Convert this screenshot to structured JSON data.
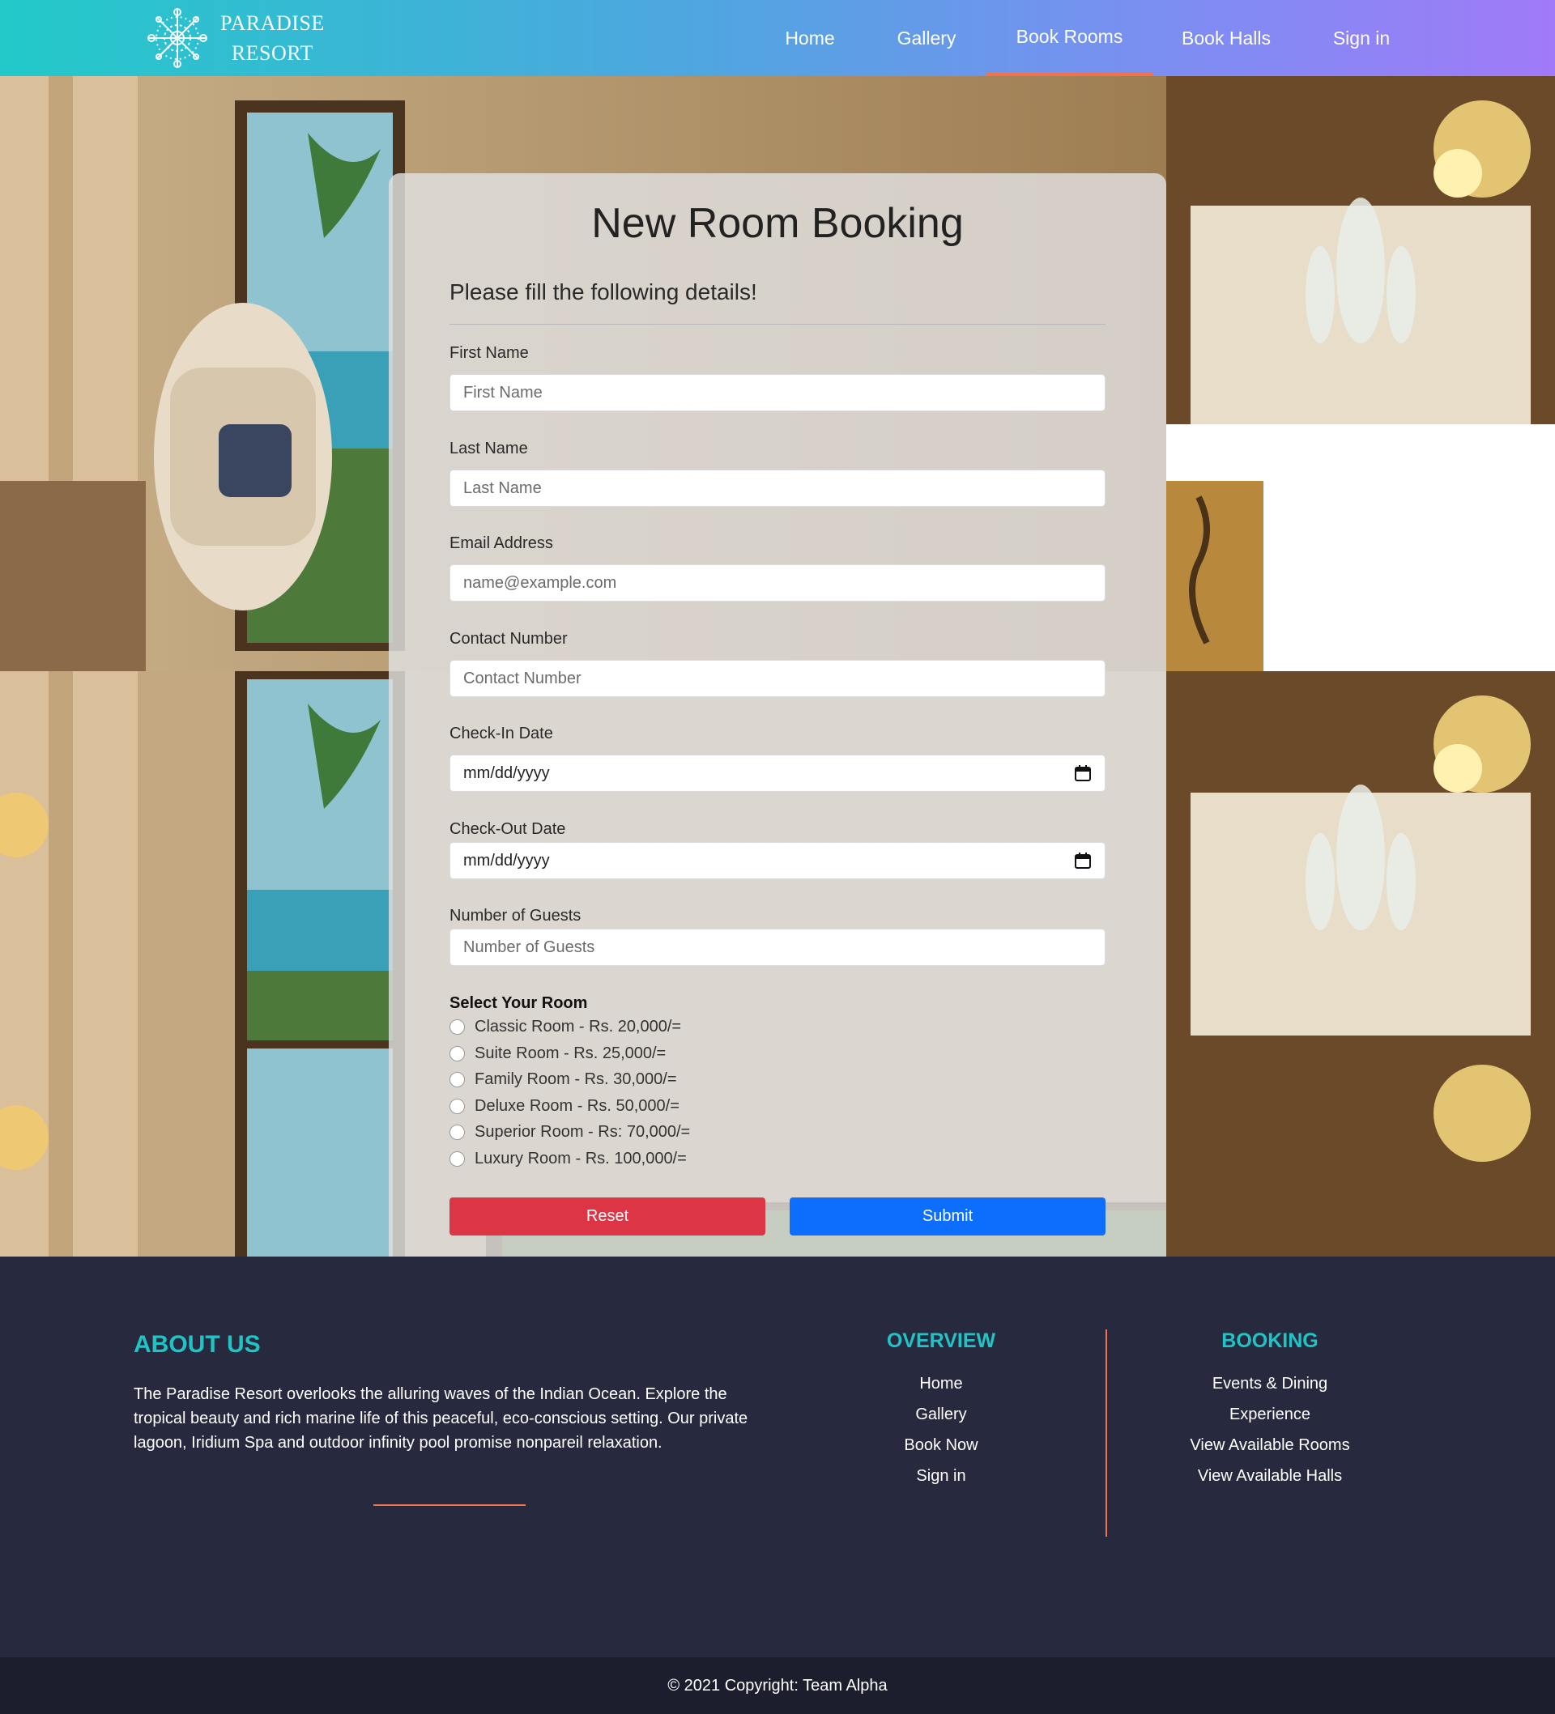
{
  "brand": {
    "line1": "PARADISE",
    "line2": "RESORT"
  },
  "nav": {
    "items": [
      {
        "label": "Home"
      },
      {
        "label": "Gallery"
      },
      {
        "label": "Book Rooms",
        "active": true
      },
      {
        "label": "Book Halls"
      },
      {
        "label": "Sign in"
      }
    ]
  },
  "form": {
    "title": "New Room Booking",
    "subtitle": "Please fill the following details!",
    "fields": {
      "first_name": {
        "label": "First Name",
        "placeholder": "First Name"
      },
      "last_name": {
        "label": "Last Name",
        "placeholder": "Last Name"
      },
      "email": {
        "label": "Email Address",
        "placeholder": "name@example.com"
      },
      "contact": {
        "label": "Contact Number",
        "placeholder": "Contact Number"
      },
      "check_in": {
        "label": "Check-In Date",
        "placeholder": "mm/dd/yyyy"
      },
      "check_out": {
        "label": "Check-Out Date",
        "placeholder": "mm/dd/yyyy"
      },
      "guests": {
        "label": "Number of Guests",
        "placeholder": "Number of Guests"
      }
    },
    "room_heading": "Select Your Room",
    "rooms": [
      {
        "label": "Classic Room - Rs. 20,000/="
      },
      {
        "label": "Suite Room - Rs. 25,000/="
      },
      {
        "label": "Family Room - Rs. 30,000/="
      },
      {
        "label": "Deluxe Room - Rs. 50,000/="
      },
      {
        "label": "Superior Room - Rs: 70,000/="
      },
      {
        "label": "Luxury Room - Rs. 100,000/="
      }
    ],
    "reset_label": "Reset",
    "submit_label": "Submit"
  },
  "footer": {
    "about_title": "ABOUT US",
    "about_text": "The Paradise Resort overlooks the alluring waves of the Indian Ocean. Explore the tropical beauty and rich marine life of this peaceful, eco-conscious setting. Our private lagoon, Iridium Spa and outdoor infinity pool promise nonpareil relaxation.",
    "overview": {
      "title": "OVERVIEW",
      "links": [
        "Home",
        "Gallery",
        "Book Now",
        "Sign in"
      ]
    },
    "booking": {
      "title": "BOOKING",
      "links": [
        "Events & Dining",
        "Experience",
        "View Available Rooms",
        "View Available Halls"
      ]
    },
    "copyright": "© 2021 Copyright: Team Alpha"
  },
  "colors": {
    "accent": "#21c4c4",
    "underline": "#f2724f",
    "reset": "#dc3545",
    "submit": "#0d6efd",
    "footer_bg": "#272a3f",
    "copyright_bg": "#1c1e2d"
  }
}
